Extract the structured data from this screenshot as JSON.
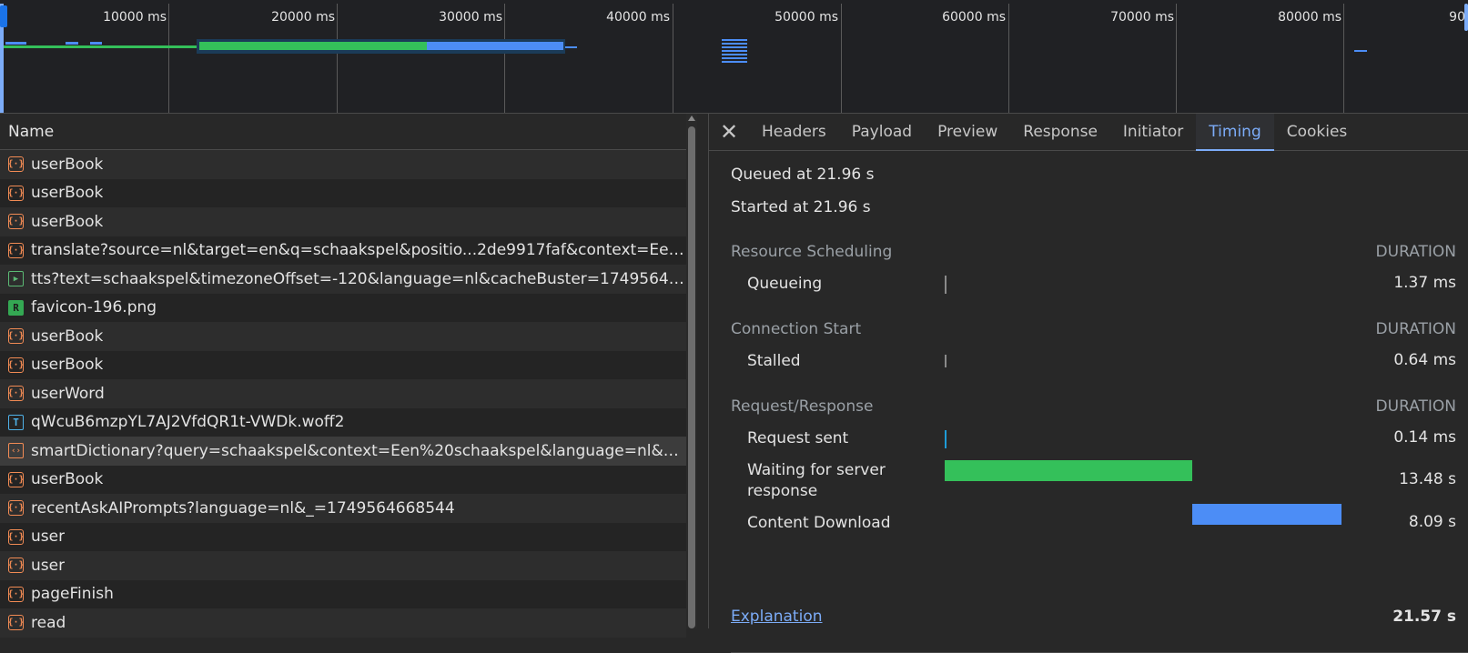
{
  "overview": {
    "tick_labels": [
      "10000 ms",
      "20000 ms",
      "30000 ms",
      "40000 ms",
      "50000 ms",
      "60000 ms",
      "70000 ms",
      "80000 ms",
      "90"
    ]
  },
  "list": {
    "header": "Name",
    "rows": [
      {
        "name": "userBook",
        "type": "json"
      },
      {
        "name": "userBook",
        "type": "json"
      },
      {
        "name": "userBook",
        "type": "json"
      },
      {
        "name": "translate?source=nl&target=en&q=schaakspel&positio...2de9917faf&context=Een+s...",
        "type": "json"
      },
      {
        "name": "tts?text=schaakspel&timezoneOffset=-120&language=nl&cacheBuster=1749564714...",
        "type": "media"
      },
      {
        "name": "favicon-196.png",
        "type": "image"
      },
      {
        "name": "userBook",
        "type": "json"
      },
      {
        "name": "userBook",
        "type": "json"
      },
      {
        "name": "userWord",
        "type": "json"
      },
      {
        "name": "qWcuB6mzpYL7AJ2VfdQR1t-VWDk.woff2",
        "type": "font"
      },
      {
        "name": "smartDictionary?query=schaakspel&context=Een%20schaakspel&language=nl&exp...",
        "type": "doc",
        "selected": true
      },
      {
        "name": "userBook",
        "type": "json"
      },
      {
        "name": "recentAskAIPrompts?language=nl&_=1749564668544",
        "type": "json"
      },
      {
        "name": "user",
        "type": "json"
      },
      {
        "name": "user",
        "type": "json"
      },
      {
        "name": "pageFinish",
        "type": "json"
      },
      {
        "name": "read",
        "type": "json"
      }
    ]
  },
  "detail": {
    "tabs": [
      {
        "label": "Headers",
        "active": false
      },
      {
        "label": "Payload",
        "active": false
      },
      {
        "label": "Preview",
        "active": false
      },
      {
        "label": "Response",
        "active": false
      },
      {
        "label": "Initiator",
        "active": false
      },
      {
        "label": "Timing",
        "active": true
      },
      {
        "label": "Cookies",
        "active": false
      }
    ],
    "queued_at": "Queued at 21.96 s",
    "started_at": "Started at 21.96 s",
    "duration_header": "DURATION",
    "sections": {
      "scheduling": {
        "title": "Resource Scheduling",
        "queueing": {
          "label": "Queueing",
          "value": "1.37 ms"
        }
      },
      "connection": {
        "title": "Connection Start",
        "stalled": {
          "label": "Stalled",
          "value": "0.64 ms"
        }
      },
      "request": {
        "title": "Request/Response",
        "sent": {
          "label": "Request sent",
          "value": "0.14 ms"
        },
        "waiting": {
          "label": "Waiting for server response",
          "value": "13.48 s"
        },
        "download": {
          "label": "Content Download",
          "value": "8.09 s"
        }
      }
    },
    "explanation": "Explanation",
    "total": "21.57 s",
    "colors": {
      "waiting": "#34c05a",
      "download": "#4c8df6",
      "request_sent": "#1e9bd7",
      "tick": "#8a8a8a"
    }
  }
}
